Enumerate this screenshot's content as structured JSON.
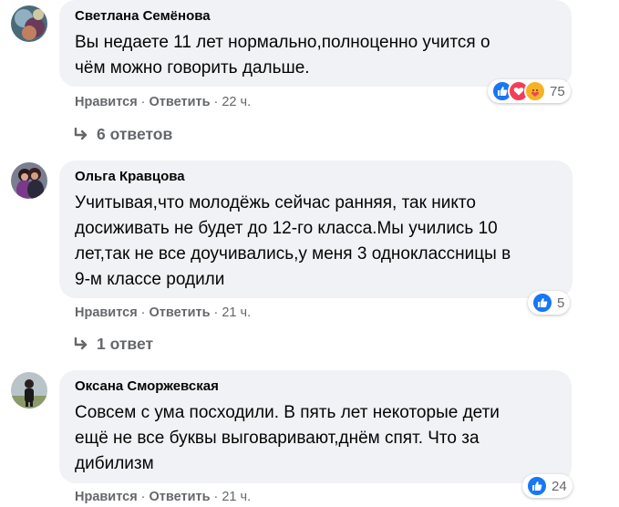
{
  "comments": [
    {
      "author": "Светлана Семёнова",
      "lines": [
        "Вы недаете 11 лет нормально,полноценно учится о",
        "чём можно говорить дальше."
      ],
      "like_label": "Нравится",
      "reply_label": "Ответить",
      "time": "22 ч.",
      "reactions": [
        "like",
        "love",
        "care"
      ],
      "reaction_count": "75",
      "replies_label": "6 ответов"
    },
    {
      "author": "Ольга Кравцова",
      "lines": [
        "Учитывая,что молодёжь сейчас ранняя, так никто",
        "досиживать не будет до 12-го класса.Мы учились 10",
        "лет,так не все доучивались,у меня 3 одноклассницы в",
        "9-м классе родили"
      ],
      "like_label": "Нравится",
      "reply_label": "Ответить",
      "time": "21 ч.",
      "reactions": [
        "like"
      ],
      "reaction_count": "5",
      "replies_label": "1 ответ"
    },
    {
      "author": "Оксана Сморжевская",
      "lines": [
        "Совсем с ума посходили. В пять лет некоторые дети",
        "ещё не все буквы выговаривают,днём спят. Что за",
        "дибилизм"
      ],
      "like_label": "Нравится",
      "reply_label": "Ответить",
      "time": "21 ч.",
      "reactions": [
        "like"
      ],
      "reaction_count": "24"
    }
  ],
  "colors": {
    "bubble": "#f0f2f5",
    "secondary_text": "#65676b",
    "like_blue": "#1877f2",
    "love_red": "#f33e58",
    "care_yellow": "#f7b125"
  }
}
